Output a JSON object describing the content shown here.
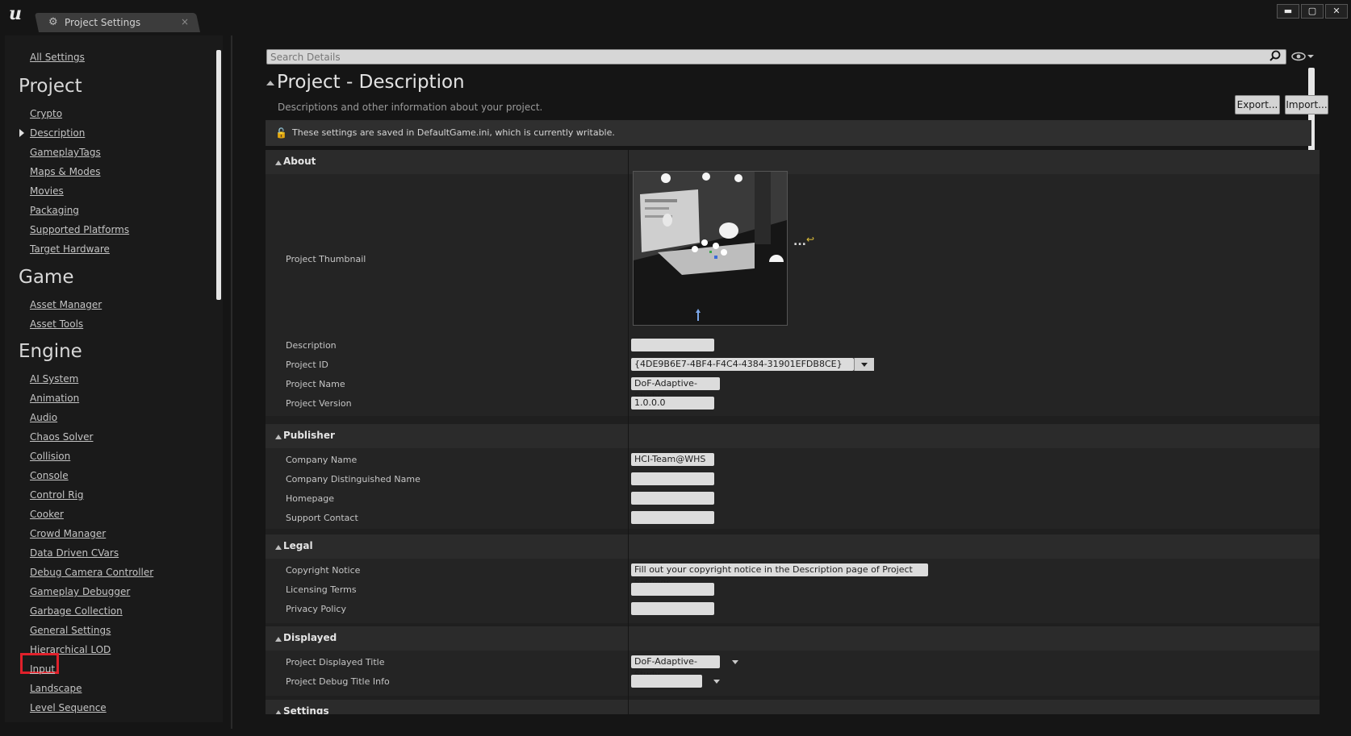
{
  "window": {
    "tab_label": "Project Settings",
    "tab_close": "×",
    "minimize": "▬",
    "maximize": "▢",
    "close": "✕"
  },
  "sidebar": {
    "all_settings": "All Settings",
    "categories": [
      {
        "title": "Project",
        "items": [
          "Crypto",
          "Description",
          "GameplayTags",
          "Maps & Modes",
          "Movies",
          "Packaging",
          "Supported Platforms",
          "Target Hardware"
        ]
      },
      {
        "title": "Game",
        "items": [
          "Asset Manager",
          "Asset Tools"
        ]
      },
      {
        "title": "Engine",
        "items": [
          "AI System",
          "Animation",
          "Audio",
          "Chaos Solver",
          "Collision",
          "Console",
          "Control Rig",
          "Cooker",
          "Crowd Manager",
          "Data Driven CVars",
          "Debug Camera Controller",
          "Gameplay Debugger",
          "Garbage Collection",
          "General Settings",
          "Hierarchical LOD",
          "Input",
          "Landscape",
          "Level Sequence"
        ]
      }
    ],
    "selected": "Description",
    "highlighted": "Input"
  },
  "search": {
    "placeholder": "Search Details"
  },
  "header": {
    "title": "Project - Description",
    "subtitle": "Descriptions and other information about your project.",
    "export_label": "Export...",
    "import_label": "Import..."
  },
  "notice": {
    "text": "These settings are saved in DefaultGame.ini, which is currently writable."
  },
  "sections": {
    "about": {
      "label": "About",
      "thumbnail_label": "Project Thumbnail",
      "description_label": "Description",
      "description_value": "",
      "project_id_label": "Project ID",
      "project_id_value": "{4DE9B6E7-4BF4-F4C4-4384-31901EFDB8CE}",
      "project_name_label": "Project Name",
      "project_name_value": "DoF-Adaptive-Study",
      "project_version_label": "Project Version",
      "project_version_value": "1.0.0.0"
    },
    "publisher": {
      "label": "Publisher",
      "company_name_label": "Company Name",
      "company_name_value": "HCI-Team@WHS",
      "company_dn_label": "Company Distinguished Name",
      "company_dn_value": "",
      "homepage_label": "Homepage",
      "homepage_value": "",
      "support_label": "Support Contact",
      "support_value": ""
    },
    "legal": {
      "label": "Legal",
      "copyright_label": "Copyright Notice",
      "copyright_value": "Fill out your copyright notice in the Description page of Project Settings.",
      "licensing_label": "Licensing Terms",
      "licensing_value": "",
      "privacy_label": "Privacy Policy",
      "privacy_value": ""
    },
    "displayed": {
      "label": "Displayed",
      "title_label": "Project Displayed Title",
      "title_value": "DoF-Adaptive-Study",
      "debug_label": "Project Debug Title Info",
      "debug_value": ""
    },
    "settings": {
      "label": "Settings"
    }
  },
  "icons": {
    "logo": "unreal-logo",
    "thumb_more": "...",
    "thumb_reset": "↩"
  },
  "colors": {
    "highlight_box": "#e0212b",
    "background": "#151515",
    "panel": "#1f1f1f"
  }
}
